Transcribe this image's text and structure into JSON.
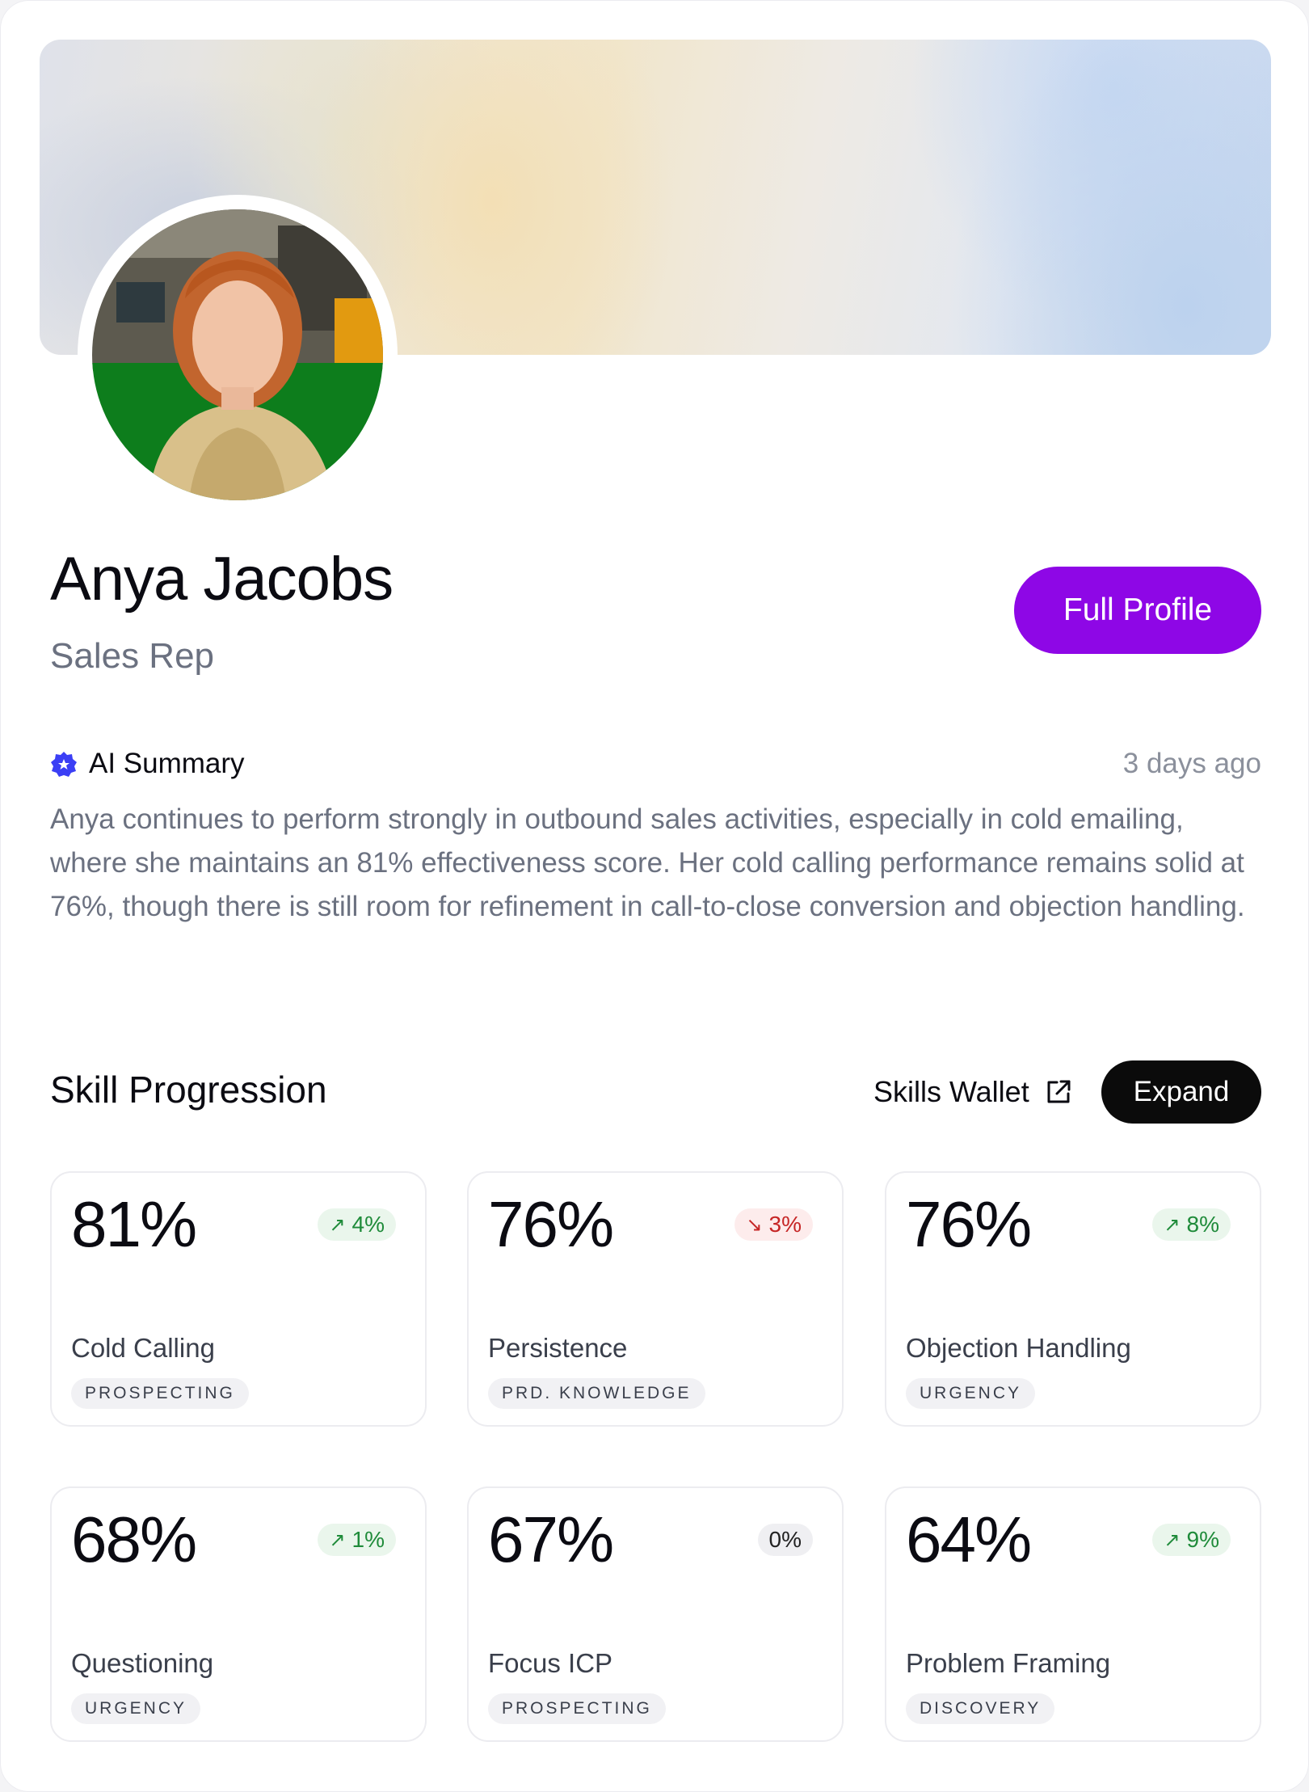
{
  "profile": {
    "name": "Anya Jacobs",
    "role": "Sales Rep",
    "full_profile_label": "Full Profile"
  },
  "ai_summary": {
    "label": "AI Summary",
    "time": "3 days ago",
    "text": "Anya continues to perform strongly in outbound sales activities, especially in cold emailing, where she maintains an 81% effectiveness score. Her cold calling performance remains solid at 76%, though there is still room for refinement in call-to-close conversion and objection handling."
  },
  "skills": {
    "title": "Skill Progression",
    "wallet_label": "Skills Wallet",
    "expand_label": "Expand",
    "items": [
      {
        "value": "81%",
        "change": "4%",
        "direction": "up",
        "name": "Cold Calling",
        "tag": "PROSPECTING"
      },
      {
        "value": "76%",
        "change": "3%",
        "direction": "down",
        "name": "Persistence",
        "tag": "PRD. KNOWLEDGE"
      },
      {
        "value": "76%",
        "change": "8%",
        "direction": "up",
        "name": "Objection Handling",
        "tag": "URGENCY"
      },
      {
        "value": "68%",
        "change": "1%",
        "direction": "up",
        "name": "Questioning",
        "tag": "URGENCY"
      },
      {
        "value": "67%",
        "change": "0%",
        "direction": "flat",
        "name": "Focus ICP",
        "tag": "PROSPECTING"
      },
      {
        "value": "64%",
        "change": "9%",
        "direction": "up",
        "name": "Problem Framing",
        "tag": "DISCOVERY"
      }
    ]
  },
  "colors": {
    "accent": "#8e07e6",
    "up": "#1f8b3a",
    "down": "#c62626",
    "ai_icon": "#3b3ff5"
  },
  "icons": {
    "ai": "verified-badge-icon",
    "wallet": "external-link-icon",
    "up": "arrow-up-right-icon",
    "down": "arrow-down-right-icon"
  }
}
